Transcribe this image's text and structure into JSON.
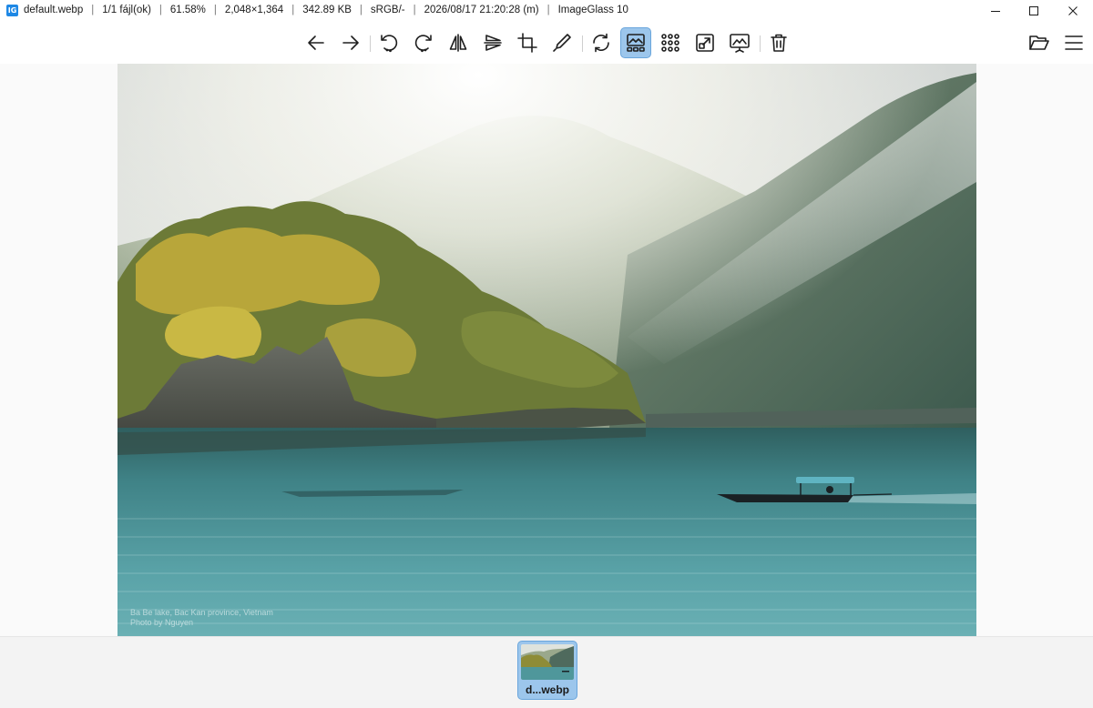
{
  "window": {
    "filename": "default.webp",
    "file_index": "1/1 fájl(ok)",
    "zoom": "61.58%",
    "dimensions": "2,048×1,364",
    "filesize": "342.89 KB",
    "color_profile": "sRGB/-",
    "datetime": "2026/08/17 21:20:28 (m)",
    "app_name": "ImageGlass 10",
    "separator": "|"
  },
  "app_icon_text": "IG",
  "toolbar": {
    "buttons": [
      {
        "icon": "arrow-left-icon",
        "label": "Previous image"
      },
      {
        "icon": "arrow-right-icon",
        "label": "Next image"
      },
      {
        "icon": "rotate-left-icon",
        "label": "Rotate left"
      },
      {
        "icon": "rotate-right-icon",
        "label": "Rotate right"
      },
      {
        "icon": "flip-horizontal-icon",
        "label": "Flip horizontal"
      },
      {
        "icon": "flip-vertical-icon",
        "label": "Flip vertical"
      },
      {
        "icon": "crop-icon",
        "label": "Crop"
      },
      {
        "icon": "color-picker-icon",
        "label": "Color picker"
      },
      {
        "icon": "refresh-icon",
        "label": "Reload"
      },
      {
        "icon": "thumbnail-bar-icon",
        "label": "Thumbnail bar",
        "active": true
      },
      {
        "icon": "gallery-grid-icon",
        "label": "Gallery"
      },
      {
        "icon": "fullscreen-icon",
        "label": "Full screen"
      },
      {
        "icon": "slideshow-icon",
        "label": "Slideshow"
      },
      {
        "icon": "delete-icon",
        "label": "Delete"
      },
      {
        "icon": "open-folder-icon",
        "label": "Open file"
      },
      {
        "icon": "menu-icon",
        "label": "Main menu"
      }
    ]
  },
  "photo": {
    "caption_line1": "Ba Be lake, Bac Kan province, Vietnam",
    "caption_line2": "Photo by Nguyen"
  },
  "thumbnail": {
    "label": "d...webp",
    "selected": true
  },
  "colors": {
    "accent": "#9cc6ec",
    "accent_border": "#6aa6dc",
    "app_icon": "#1e88e5"
  }
}
